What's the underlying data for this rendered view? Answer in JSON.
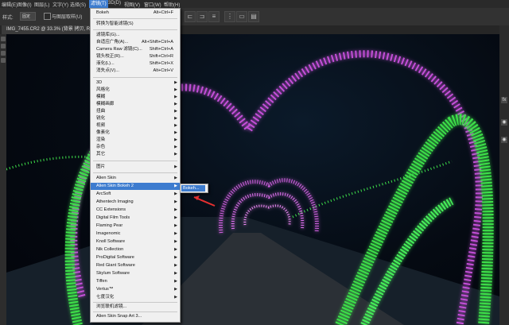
{
  "menubar": {
    "items": [
      "编辑(E)",
      "图像(I)",
      "图层(L)",
      "文字(Y)",
      "选择(S)",
      "滤镜(T)",
      "3D(D)",
      "视图(V)",
      "窗口(W)",
      "帮助(H)"
    ]
  },
  "options": {
    "label": "样式:",
    "select_value": "固定",
    "checkbox_label": "与图层取样(U)"
  },
  "document": {
    "tab_title": "IMG_7455.CR2 @ 33.3% (背景 拷贝, RGB/8)"
  },
  "panel_icons": [
    "fx",
    "◉",
    "◉"
  ],
  "filter_menu": {
    "last_filter": {
      "label": "Bokeh",
      "shortcut": "Alt+Ctrl+F"
    },
    "convert_smart": "转换为智能滤镜(S)",
    "group1": [
      {
        "label": "滤镜库(G)...",
        "shortcut": ""
      },
      {
        "label": "自适应广角(A)...",
        "shortcut": "Alt+Shift+Ctrl+A"
      },
      {
        "label": "Camera Raw 滤镜(C)...",
        "shortcut": "Shift+Ctrl+A"
      },
      {
        "label": "镜头校正(R)...",
        "shortcut": "Shift+Ctrl+R"
      },
      {
        "label": "液化(L)...",
        "shortcut": "Shift+Ctrl+X"
      },
      {
        "label": "消失点(V)...",
        "shortcut": "Alt+Ctrl+V"
      }
    ],
    "group2": [
      "3D",
      "风格化",
      "模糊",
      "模糊画廊",
      "扭曲",
      "锐化",
      "视频",
      "像素化",
      "渲染",
      "杂色",
      "其它"
    ],
    "group3_header": "图片",
    "group3": [
      "Alien Skin",
      "Alien Skin Bokeh 2",
      "ArcSoft",
      "Athentech Imaging",
      "CC Extensions",
      "Digital Film Tools",
      "Flaming Pear",
      "Imagenomic",
      "Knoll Software",
      "Nik Collection",
      "ProDigital Software",
      "Red Giant Software",
      "Skylum Software",
      "Tiffen",
      "Vertus™",
      "七度汉化"
    ],
    "browse": "浏览联机滤镜...",
    "bottom_item": "Alien Skin Snap Art 3..."
  },
  "submenu": {
    "item": "Bokeh..."
  },
  "colors": {
    "accent": "#3d7ccf",
    "menu_bg": "#f0f0f0",
    "app_bg": "#2a2a2a"
  }
}
